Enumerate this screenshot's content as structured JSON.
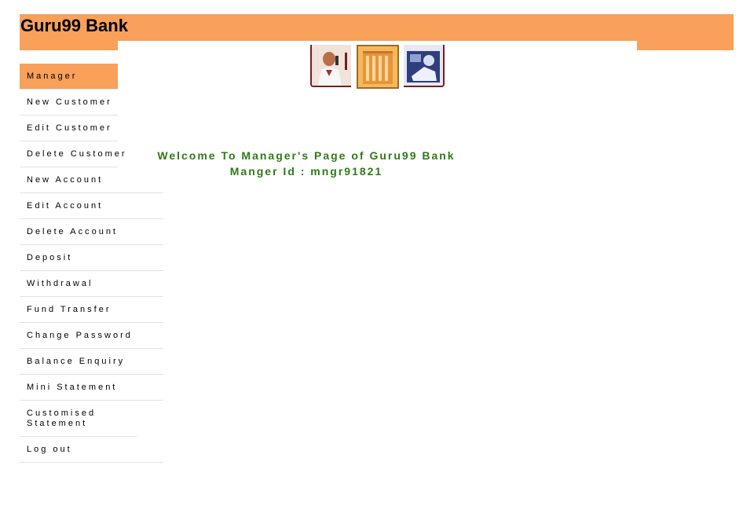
{
  "brand": "Guru99 Bank",
  "welcome": {
    "title": "Welcome To Manager's Page of Guru99 Bank",
    "manager_id_text": "Manger Id : mngr91821"
  },
  "menu": {
    "items": [
      {
        "label": "Manager"
      },
      {
        "label": "New Customer"
      },
      {
        "label": "Edit Customer"
      },
      {
        "label": "Delete Customer"
      },
      {
        "label": "New Account"
      },
      {
        "label": "Edit Account"
      },
      {
        "label": "Delete Account"
      },
      {
        "label": "Deposit"
      },
      {
        "label": "Withdrawal"
      },
      {
        "label": "Fund Transfer"
      },
      {
        "label": "Change Password"
      },
      {
        "label": "Balance Enquiry"
      },
      {
        "label": "Mini Statement"
      },
      {
        "label": "Customised Statement"
      },
      {
        "label": "Log out"
      }
    ]
  },
  "header_images": [
    {
      "icon": "businessman-phone-icon"
    },
    {
      "icon": "bank-building-icon"
    },
    {
      "icon": "woman-reading-icon"
    }
  ],
  "colors": {
    "accent": "#f9a05a",
    "welcome_text": "#2f7a16"
  }
}
